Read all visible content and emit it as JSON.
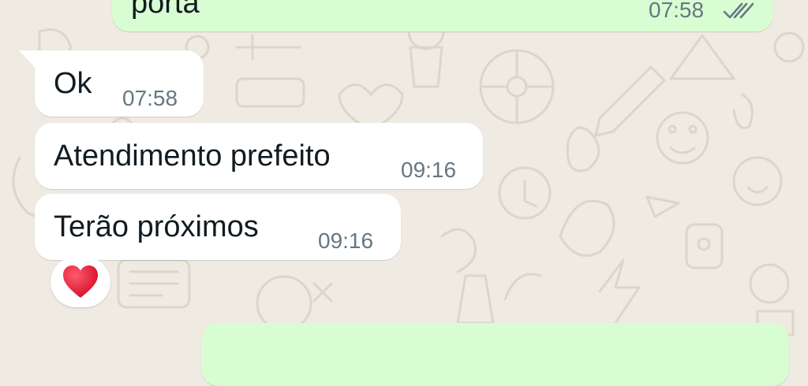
{
  "chat": {
    "outgoing_top": {
      "text": "porta",
      "time": "07:58",
      "status_icon": "double-check-icon"
    },
    "messages": [
      {
        "text": "Ok",
        "time": "07:58"
      },
      {
        "text": "Atendimento prefeito",
        "time": "09:16"
      },
      {
        "text": "Terão próximos",
        "time": "09:16",
        "reaction": "heart-icon"
      }
    ]
  },
  "colors": {
    "wallpaper": "#efeae2",
    "incoming_bubble": "#ffffff",
    "outgoing_bubble": "#d9fdd3",
    "text": "#111b21",
    "timestamp": "#667781",
    "reaction_heart": "#e8112d"
  }
}
